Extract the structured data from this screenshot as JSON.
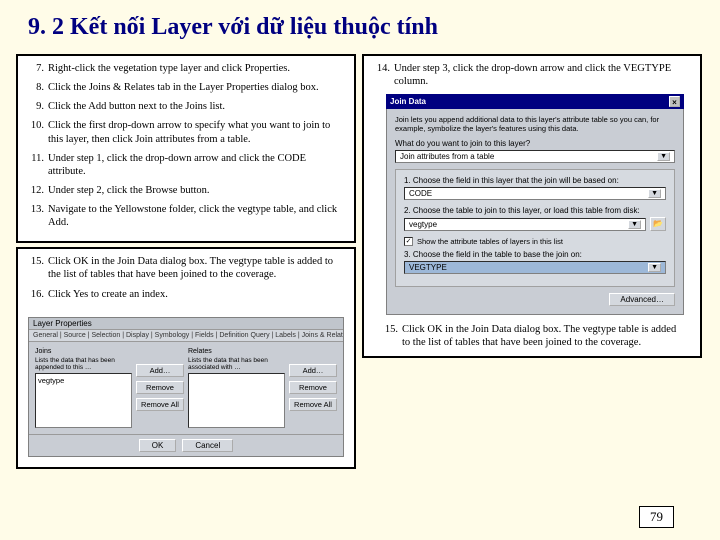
{
  "title": "9. 2 Kết nối Layer với dữ liệu thuộc tính",
  "page_number": "79",
  "panelA": {
    "steps": [
      {
        "n": "7.",
        "t": "Right-click the vegetation type layer and click Properties."
      },
      {
        "n": "8.",
        "t": "Click the Joins & Relates tab in the Layer Properties dialog box."
      },
      {
        "n": "9.",
        "t": "Click the Add button next to the Joins list."
      },
      {
        "n": "10.",
        "t": "Click the first drop-down arrow to specify what you want to join to this layer, then click Join attributes from a table."
      },
      {
        "n": "11.",
        "t": "Under step 1, click the drop-down arrow and click the CODE attribute."
      },
      {
        "n": "12.",
        "t": "Under step 2, click the Browse button."
      },
      {
        "n": "13.",
        "t": "Navigate to the Yellowstone folder, click the vegtype table, and click Add."
      }
    ]
  },
  "panelC": {
    "steps": [
      {
        "n": "15.",
        "t": "Click OK in the Join Data dialog box. The vegtype table is added to the list of tables that have been joined to the coverage."
      },
      {
        "n": "16.",
        "t": "Click Yes to create an index."
      }
    ],
    "lp": {
      "title": "Layer Properties",
      "tabs": "General | Source | Selection | Display | Symbology | Fields | Definition Query | Labels | Joins & Relates",
      "joins_label": "Joins",
      "relates_label": "Relates",
      "joins_caption": "Lists the data that has been appended to this …",
      "relates_caption": "Lists the data that has been associated with …",
      "join_item": "vegtype",
      "btn_add": "Add…",
      "btn_remove": "Remove",
      "btn_removeall": "Remove All",
      "btn_ok": "OK",
      "btn_cancel": "Cancel"
    }
  },
  "panelB": {
    "step14": {
      "n": "14.",
      "t": "Under step 3, click the drop-down arrow and click the VEGTYPE column."
    },
    "jd": {
      "title": "Join Data",
      "close": "×",
      "intro": "Join lets you append additional data to this layer's attribute table so you can, for example, symbolize the layer's features using this data.",
      "question": "What do you want to join to this layer?",
      "combo_val": "Join attributes from a table",
      "s1": "1. Choose the field in this layer that the join will be based on:",
      "s1_val": "CODE",
      "s2": "2. Choose the table to join to this layer, or load this table from disk:",
      "s2_val": "vegtype",
      "s2_open": "📂",
      "s2_chk_mark": "✓",
      "s2_chk": "Show the attribute tables of layers in this list",
      "s3": "3. Choose the field in the table to base the join on:",
      "s3_val": "VEGTYPE",
      "adv": "Advanced…"
    },
    "step15": {
      "n": "15.",
      "t": "Click OK in the Join Data dialog box. The vegtype table is added to the list of tables that have been joined to the coverage."
    }
  }
}
